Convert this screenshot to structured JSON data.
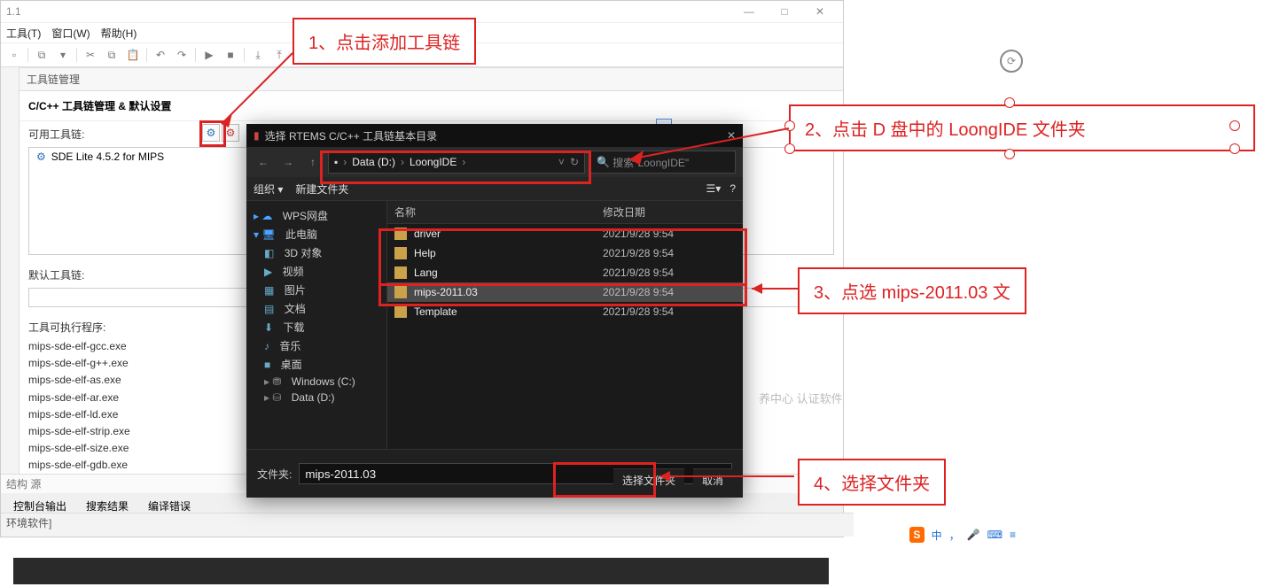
{
  "app": {
    "title_suffix": "1.1",
    "winbtns": {
      "min": "—",
      "max": "□",
      "close": "✕"
    }
  },
  "menu": {
    "tools": "工具(T)",
    "window": "窗口(W)",
    "help": "帮助(H)"
  },
  "panel": {
    "tab": "工具链管理",
    "header": "C/C++ 工具链管理 & 默认设置",
    "available": "可用工具链:",
    "item": "SDE Lite 4.5.2 for MIPS",
    "default": "默认工具链:",
    "exes_label": "工具可执行程序:",
    "exes": [
      "mips-sde-elf-gcc.exe",
      "mips-sde-elf-g++.exe",
      "mips-sde-elf-as.exe",
      "mips-sde-elf-ar.exe",
      "mips-sde-elf-ld.exe",
      "mips-sde-elf-strip.exe",
      "mips-sde-elf-size.exe",
      "mips-sde-elf-gdb.exe"
    ]
  },
  "bottom_tabs": {
    "a": "控制台输出",
    "b": "搜索结果",
    "c": "编译错误"
  },
  "status": "环境软件]",
  "vtab": "结构 源",
  "dlg": {
    "title": "选择 RTEMS C/C++ 工具链基本目录",
    "crumbs": {
      "drive": "Data (D:)",
      "folder": "LoongIDE"
    },
    "search_ph": "搜索\"LoongIDE\"",
    "org": "组织 ▾",
    "newf": "新建文件夹",
    "view": "☰▾",
    "help": "?",
    "tree": {
      "wps": "WPS网盘",
      "pc": "此电脑",
      "3d": "3D 对象",
      "video": "视频",
      "pic": "图片",
      "doc": "文档",
      "dl": "下载",
      "music": "音乐",
      "desk": "桌面",
      "cdrive": "Windows (C:)",
      "ddrive": "Data (D:)"
    },
    "fhead": {
      "name": "名称",
      "date": "修改日期"
    },
    "rows": [
      {
        "name": "driver",
        "date": "2021/9/28 9:54"
      },
      {
        "name": "Help",
        "date": "2021/9/28 9:54"
      },
      {
        "name": "Lang",
        "date": "2021/9/28 9:54"
      },
      {
        "name": "mips-2011.03",
        "date": "2021/9/28 9:54"
      },
      {
        "name": "Template",
        "date": "2021/9/28 9:54"
      }
    ],
    "foot": {
      "label": "文件夹:",
      "value": "mips-2011.03",
      "ok": "选择文件夹",
      "cancel": "取消"
    }
  },
  "ann": {
    "a1": "1、点击添加工具链",
    "a2": "2、点击 D 盘中的 LoongIDE 文件夹",
    "a3": "3、点选 mips-2011.03 文",
    "a4": "4、选择文件夹"
  },
  "grayhint": "养中心  认证软件",
  "tray": {
    "zh": "中",
    "mic": "",
    "grid": ""
  }
}
